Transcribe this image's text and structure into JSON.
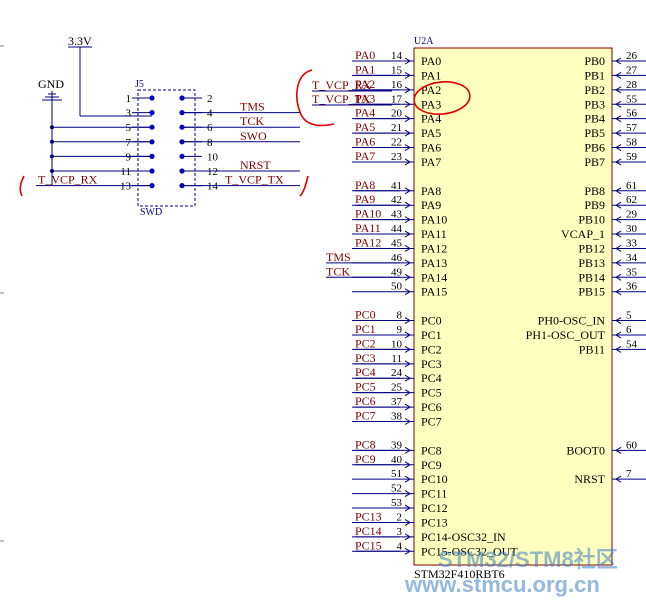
{
  "power": {
    "vcc_label": "3.3V",
    "gnd_label": "GND"
  },
  "connector": {
    "ref": "J5",
    "footer": "SWD",
    "rows": [
      {
        "l": "1",
        "r": "2",
        "left_net": "",
        "right_net": ""
      },
      {
        "l": "3",
        "r": "4",
        "left_net": "",
        "right_net": "TMS"
      },
      {
        "l": "5",
        "r": "6",
        "left_net": "",
        "right_net": "TCK"
      },
      {
        "l": "7",
        "r": "8",
        "left_net": "",
        "right_net": "SWO"
      },
      {
        "l": "9",
        "r": "10",
        "left_net": "",
        "right_net": ""
      },
      {
        "l": "11",
        "r": "12",
        "left_net": "",
        "right_net": "NRST"
      },
      {
        "l": "13",
        "r": "14",
        "left_net": "T_VCP_RX",
        "right_net": "T_VCP_TX"
      }
    ]
  },
  "mcu": {
    "ref": "U2A",
    "part": "STM32F410RBT6",
    "left_pins": [
      {
        "num": "14",
        "name": "PA0",
        "net": "PA0",
        "gap": 0
      },
      {
        "num": "15",
        "name": "PA1",
        "net": "PA1",
        "gap": 0
      },
      {
        "num": "16",
        "name": "PA2",
        "net": "PA2",
        "gap": 0
      },
      {
        "num": "17",
        "name": "PA3",
        "net": "PA3",
        "gap": 0
      },
      {
        "num": "20",
        "name": "PA4",
        "net": "PA4",
        "gap": 0
      },
      {
        "num": "21",
        "name": "PA5",
        "net": "PA5",
        "gap": 0
      },
      {
        "num": "22",
        "name": "PA6",
        "net": "PA6",
        "gap": 0
      },
      {
        "num": "23",
        "name": "PA7",
        "net": "PA7",
        "gap": 0
      },
      {
        "num": "41",
        "name": "PA8",
        "net": "PA8",
        "gap": 1
      },
      {
        "num": "42",
        "name": "PA9",
        "net": "PA9",
        "gap": 0
      },
      {
        "num": "43",
        "name": "PA10",
        "net": "PA10",
        "gap": 0
      },
      {
        "num": "44",
        "name": "PA11",
        "net": "PA11",
        "gap": 0
      },
      {
        "num": "45",
        "name": "PA12",
        "net": "PA12",
        "gap": 0
      },
      {
        "num": "46",
        "name": "PA13",
        "net": "TMS",
        "gap": 0
      },
      {
        "num": "49",
        "name": "PA14",
        "net": "TCK",
        "gap": 0
      },
      {
        "num": "50",
        "name": "PA15",
        "net": "",
        "gap": 0
      },
      {
        "num": "8",
        "name": "PC0",
        "net": "PC0",
        "gap": 1
      },
      {
        "num": "9",
        "name": "PC1",
        "net": "PC1",
        "gap": 0
      },
      {
        "num": "10",
        "name": "PC2",
        "net": "PC2",
        "gap": 0
      },
      {
        "num": "11",
        "name": "PC3",
        "net": "PC3",
        "gap": 0
      },
      {
        "num": "24",
        "name": "PC4",
        "net": "PC4",
        "gap": 0
      },
      {
        "num": "25",
        "name": "PC5",
        "net": "PC5",
        "gap": 0
      },
      {
        "num": "37",
        "name": "PC6",
        "net": "PC6",
        "gap": 0
      },
      {
        "num": "38",
        "name": "PC7",
        "net": "PC7",
        "gap": 0
      },
      {
        "num": "39",
        "name": "PC8",
        "net": "PC8",
        "gap": 1
      },
      {
        "num": "40",
        "name": "PC9",
        "net": "PC9",
        "gap": 0
      },
      {
        "num": "51",
        "name": "PC10",
        "net": "",
        "gap": 0
      },
      {
        "num": "52",
        "name": "PC11",
        "net": "",
        "gap": 0
      },
      {
        "num": "53",
        "name": "PC12",
        "net": "",
        "gap": 0
      },
      {
        "num": "2",
        "name": "PC13",
        "net": "PC13",
        "gap": 0
      },
      {
        "num": "3",
        "name": "PC14-OSC32_IN",
        "net": "PC14",
        "gap": 0
      },
      {
        "num": "4",
        "name": "PC15-OSC32_OUT",
        "net": "PC15",
        "gap": 0
      }
    ],
    "right_pins": [
      {
        "num": "26",
        "name": "PB0",
        "row": 0
      },
      {
        "num": "27",
        "name": "PB1",
        "row": 1
      },
      {
        "num": "28",
        "name": "PB2",
        "row": 2
      },
      {
        "num": "55",
        "name": "PB3",
        "row": 3
      },
      {
        "num": "56",
        "name": "PB4",
        "row": 4
      },
      {
        "num": "57",
        "name": "PB5",
        "row": 5
      },
      {
        "num": "58",
        "name": "PB6",
        "row": 6
      },
      {
        "num": "59",
        "name": "PB7",
        "row": 7
      },
      {
        "num": "61",
        "name": "PB8",
        "row": 9
      },
      {
        "num": "62",
        "name": "PB9",
        "row": 10
      },
      {
        "num": "29",
        "name": "PB10",
        "row": 11
      },
      {
        "num": "30",
        "name": "VCAP_1",
        "row": 12
      },
      {
        "num": "33",
        "name": "PB12",
        "row": 13
      },
      {
        "num": "34",
        "name": "PB13",
        "row": 14
      },
      {
        "num": "35",
        "name": "PB14",
        "row": 15
      },
      {
        "num": "36",
        "name": "PB15",
        "row": 16
      },
      {
        "num": "5",
        "name": "PH0-OSC_IN",
        "row": 18
      },
      {
        "num": "6",
        "name": "PH1-OSC_OUT",
        "row": 19
      },
      {
        "num": "54",
        "name": "PB11",
        "row": 20
      },
      {
        "num": "60",
        "name": "BOOT0",
        "row": 27
      },
      {
        "num": "7",
        "name": "NRST",
        "row": 29
      }
    ]
  },
  "vcp_nets": {
    "rx": "T_VCP_RX",
    "tx": "T_VCP_TX"
  },
  "watermark": {
    "line1": "STM32/STM8社区",
    "line2": "www.stmcu.org.cn"
  },
  "colors": {
    "body_fill": "#ffffc0",
    "body_stroke": "#800000",
    "wire": "#000080",
    "net_text": "#800000",
    "annotation": "#e00000"
  }
}
